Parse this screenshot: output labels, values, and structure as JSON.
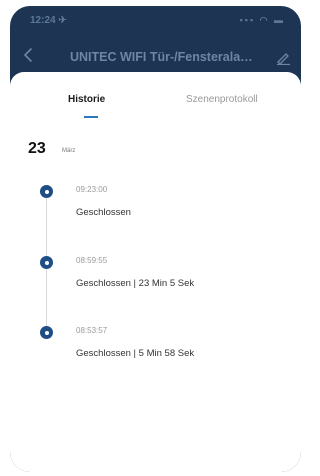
{
  "status_bar": {
    "time": "12:24 ✈",
    "icons": "▪▪▪ ◠ ▬"
  },
  "nav": {
    "title": "UNITEC WIFI Tür-/Fensterala…"
  },
  "tabs": [
    {
      "label": "Historie",
      "active": true
    },
    {
      "label": "Szenenprotokoll",
      "active": false
    }
  ],
  "date": {
    "day": "23",
    "month": "März"
  },
  "entries": [
    {
      "time": "09:23:00",
      "status": "Geschlossen"
    },
    {
      "time": "08:59:55",
      "status": "Geschlossen  | 23 Min 5 Sek"
    },
    {
      "time": "08:53:57",
      "status": "Geschlossen  | 5 Min 58 Sek"
    }
  ],
  "colors": {
    "header_bg": "#1d3553",
    "accent": "#2a78c0",
    "dot": "#1f4e86"
  }
}
